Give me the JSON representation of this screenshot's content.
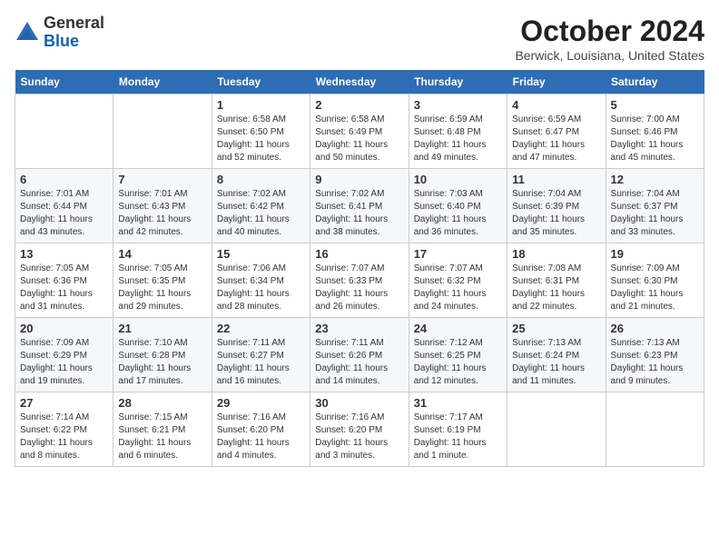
{
  "logo": {
    "general": "General",
    "blue": "Blue"
  },
  "title": "October 2024",
  "location": "Berwick, Louisiana, United States",
  "days_header": [
    "Sunday",
    "Monday",
    "Tuesday",
    "Wednesday",
    "Thursday",
    "Friday",
    "Saturday"
  ],
  "weeks": [
    [
      {
        "day": "",
        "info": ""
      },
      {
        "day": "",
        "info": ""
      },
      {
        "day": "1",
        "info": "Sunrise: 6:58 AM\nSunset: 6:50 PM\nDaylight: 11 hours and 52 minutes."
      },
      {
        "day": "2",
        "info": "Sunrise: 6:58 AM\nSunset: 6:49 PM\nDaylight: 11 hours and 50 minutes."
      },
      {
        "day": "3",
        "info": "Sunrise: 6:59 AM\nSunset: 6:48 PM\nDaylight: 11 hours and 49 minutes."
      },
      {
        "day": "4",
        "info": "Sunrise: 6:59 AM\nSunset: 6:47 PM\nDaylight: 11 hours and 47 minutes."
      },
      {
        "day": "5",
        "info": "Sunrise: 7:00 AM\nSunset: 6:46 PM\nDaylight: 11 hours and 45 minutes."
      }
    ],
    [
      {
        "day": "6",
        "info": "Sunrise: 7:01 AM\nSunset: 6:44 PM\nDaylight: 11 hours and 43 minutes."
      },
      {
        "day": "7",
        "info": "Sunrise: 7:01 AM\nSunset: 6:43 PM\nDaylight: 11 hours and 42 minutes."
      },
      {
        "day": "8",
        "info": "Sunrise: 7:02 AM\nSunset: 6:42 PM\nDaylight: 11 hours and 40 minutes."
      },
      {
        "day": "9",
        "info": "Sunrise: 7:02 AM\nSunset: 6:41 PM\nDaylight: 11 hours and 38 minutes."
      },
      {
        "day": "10",
        "info": "Sunrise: 7:03 AM\nSunset: 6:40 PM\nDaylight: 11 hours and 36 minutes."
      },
      {
        "day": "11",
        "info": "Sunrise: 7:04 AM\nSunset: 6:39 PM\nDaylight: 11 hours and 35 minutes."
      },
      {
        "day": "12",
        "info": "Sunrise: 7:04 AM\nSunset: 6:37 PM\nDaylight: 11 hours and 33 minutes."
      }
    ],
    [
      {
        "day": "13",
        "info": "Sunrise: 7:05 AM\nSunset: 6:36 PM\nDaylight: 11 hours and 31 minutes."
      },
      {
        "day": "14",
        "info": "Sunrise: 7:05 AM\nSunset: 6:35 PM\nDaylight: 11 hours and 29 minutes."
      },
      {
        "day": "15",
        "info": "Sunrise: 7:06 AM\nSunset: 6:34 PM\nDaylight: 11 hours and 28 minutes."
      },
      {
        "day": "16",
        "info": "Sunrise: 7:07 AM\nSunset: 6:33 PM\nDaylight: 11 hours and 26 minutes."
      },
      {
        "day": "17",
        "info": "Sunrise: 7:07 AM\nSunset: 6:32 PM\nDaylight: 11 hours and 24 minutes."
      },
      {
        "day": "18",
        "info": "Sunrise: 7:08 AM\nSunset: 6:31 PM\nDaylight: 11 hours and 22 minutes."
      },
      {
        "day": "19",
        "info": "Sunrise: 7:09 AM\nSunset: 6:30 PM\nDaylight: 11 hours and 21 minutes."
      }
    ],
    [
      {
        "day": "20",
        "info": "Sunrise: 7:09 AM\nSunset: 6:29 PM\nDaylight: 11 hours and 19 minutes."
      },
      {
        "day": "21",
        "info": "Sunrise: 7:10 AM\nSunset: 6:28 PM\nDaylight: 11 hours and 17 minutes."
      },
      {
        "day": "22",
        "info": "Sunrise: 7:11 AM\nSunset: 6:27 PM\nDaylight: 11 hours and 16 minutes."
      },
      {
        "day": "23",
        "info": "Sunrise: 7:11 AM\nSunset: 6:26 PM\nDaylight: 11 hours and 14 minutes."
      },
      {
        "day": "24",
        "info": "Sunrise: 7:12 AM\nSunset: 6:25 PM\nDaylight: 11 hours and 12 minutes."
      },
      {
        "day": "25",
        "info": "Sunrise: 7:13 AM\nSunset: 6:24 PM\nDaylight: 11 hours and 11 minutes."
      },
      {
        "day": "26",
        "info": "Sunrise: 7:13 AM\nSunset: 6:23 PM\nDaylight: 11 hours and 9 minutes."
      }
    ],
    [
      {
        "day": "27",
        "info": "Sunrise: 7:14 AM\nSunset: 6:22 PM\nDaylight: 11 hours and 8 minutes."
      },
      {
        "day": "28",
        "info": "Sunrise: 7:15 AM\nSunset: 6:21 PM\nDaylight: 11 hours and 6 minutes."
      },
      {
        "day": "29",
        "info": "Sunrise: 7:16 AM\nSunset: 6:20 PM\nDaylight: 11 hours and 4 minutes."
      },
      {
        "day": "30",
        "info": "Sunrise: 7:16 AM\nSunset: 6:20 PM\nDaylight: 11 hours and 3 minutes."
      },
      {
        "day": "31",
        "info": "Sunrise: 7:17 AM\nSunset: 6:19 PM\nDaylight: 11 hours and 1 minute."
      },
      {
        "day": "",
        "info": ""
      },
      {
        "day": "",
        "info": ""
      }
    ]
  ]
}
